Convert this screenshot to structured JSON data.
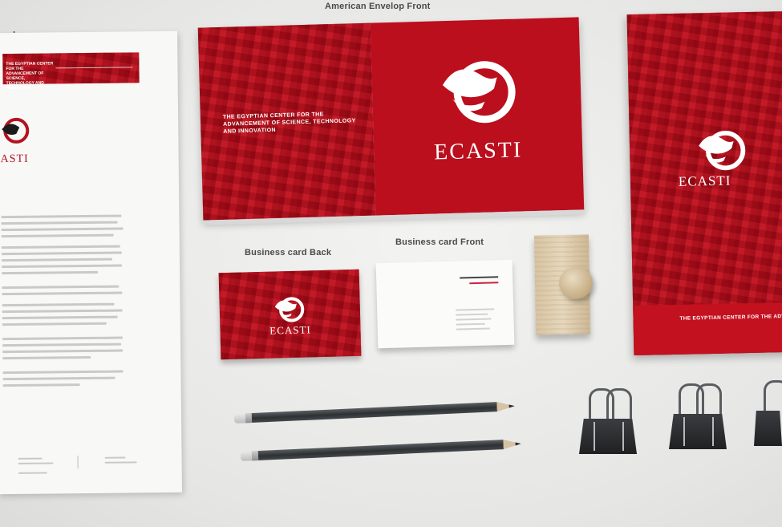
{
  "labels": {
    "letterhead_partial": "ad",
    "envelope": "American Envelop Front",
    "card_back": "Business card Back",
    "card_front": "Business card Front"
  },
  "brand": {
    "name": "ECASTI",
    "tagline": "THE EGYPTIAN CENTER FOR THE ADVANCEMENT OF SCIENCE, TECHNOLOGY AND INNOVATION",
    "letterhead_logo_text": "ASTI",
    "primary_color": "#b5121f"
  },
  "icons": {
    "logo": "bird-circle-logo-icon",
    "clip": "binder-clip-icon"
  }
}
